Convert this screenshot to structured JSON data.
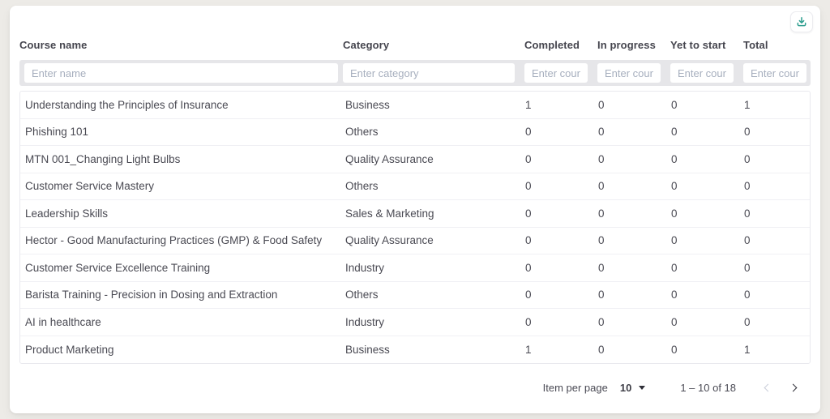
{
  "colors": {
    "page_background": "#edebe7",
    "accent_teal": "#2e9e8f",
    "header_text": "#45454e",
    "body_text": "#4a4a53",
    "placeholder_text": "#a7afbe",
    "filter_strip": "#e6e6e9",
    "disabled_chevron": "#c9cdd9"
  },
  "toolbar": {
    "download_icon": "download-icon"
  },
  "table": {
    "columns": [
      {
        "label": "Course name",
        "placeholder": "Enter name",
        "filter_value": ""
      },
      {
        "label": "Category",
        "placeholder": "Enter category",
        "filter_value": ""
      },
      {
        "label": "Completed",
        "placeholder": "Enter count",
        "filter_value": ""
      },
      {
        "label": "In progress",
        "placeholder": "Enter count",
        "filter_value": ""
      },
      {
        "label": "Yet to start",
        "placeholder": "Enter count",
        "filter_value": ""
      },
      {
        "label": "Total",
        "placeholder": "Enter count",
        "filter_value": ""
      }
    ],
    "rows": [
      {
        "name": "Understanding the Principles of Insurance",
        "category": "Business",
        "completed": "1",
        "in_progress": "0",
        "yet_to_start": "0",
        "total": "1"
      },
      {
        "name": "Phishing 101",
        "category": "Others",
        "completed": "0",
        "in_progress": "0",
        "yet_to_start": "0",
        "total": "0"
      },
      {
        "name": "MTN 001_Changing Light Bulbs",
        "category": "Quality Assurance",
        "completed": "0",
        "in_progress": "0",
        "yet_to_start": "0",
        "total": "0"
      },
      {
        "name": "Customer Service Mastery",
        "category": "Others",
        "completed": "0",
        "in_progress": "0",
        "yet_to_start": "0",
        "total": "0"
      },
      {
        "name": "Leadership Skills",
        "category": "Sales & Marketing",
        "completed": "0",
        "in_progress": "0",
        "yet_to_start": "0",
        "total": "0"
      },
      {
        "name": "Hector - Good Manufacturing Practices (GMP) & Food Safety",
        "category": "Quality Assurance",
        "completed": "0",
        "in_progress": "0",
        "yet_to_start": "0",
        "total": "0"
      },
      {
        "name": "Customer Service Excellence Training",
        "category": "Industry",
        "completed": "0",
        "in_progress": "0",
        "yet_to_start": "0",
        "total": "0"
      },
      {
        "name": "Barista Training - Precision in Dosing and Extraction",
        "category": "Others",
        "completed": "0",
        "in_progress": "0",
        "yet_to_start": "0",
        "total": "0"
      },
      {
        "name": "AI in healthcare",
        "category": "Industry",
        "completed": "0",
        "in_progress": "0",
        "yet_to_start": "0",
        "total": "0"
      },
      {
        "name": "Product Marketing",
        "category": "Business",
        "completed": "1",
        "in_progress": "0",
        "yet_to_start": "0",
        "total": "1"
      }
    ]
  },
  "pagination": {
    "items_per_page_label": "Item per page",
    "items_per_page_value": "10",
    "range_text": "1 – 10 of 18"
  }
}
